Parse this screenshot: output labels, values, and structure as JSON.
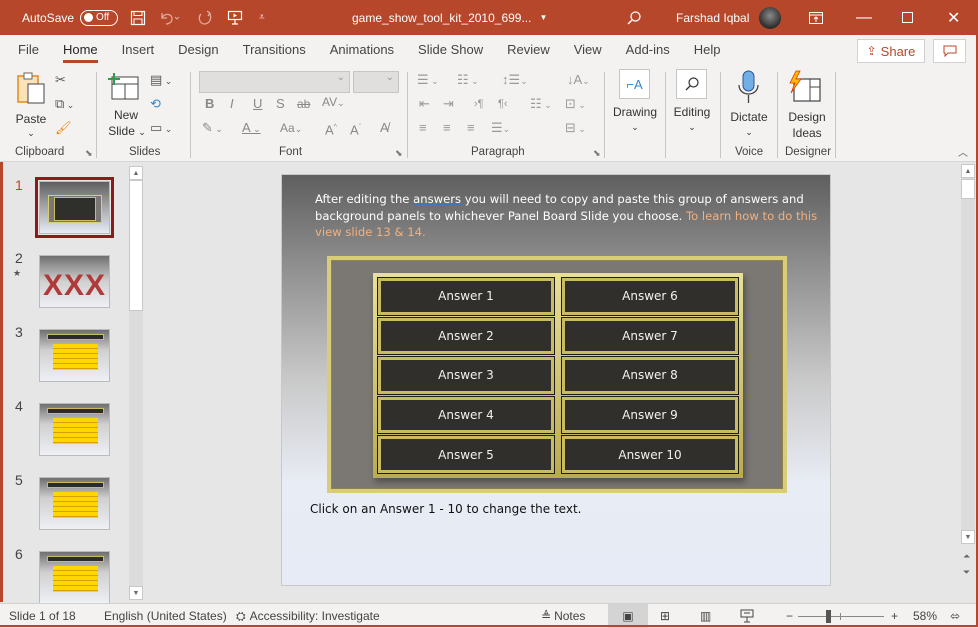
{
  "titlebar": {
    "autosave_label": "AutoSave",
    "autosave_state": "Off",
    "document_title": "game_show_tool_kit_2010_699...",
    "user_name": "Farshad Iqbal",
    "icons": [
      "save-icon",
      "undo-icon",
      "redo-icon",
      "present-from-beginning-icon",
      "customize-qat-icon",
      "search-icon",
      "ribbon-display-options-icon",
      "minimize-icon",
      "maximize-icon",
      "close-icon"
    ]
  },
  "tabs": [
    {
      "label": "File"
    },
    {
      "label": "Home",
      "active": true
    },
    {
      "label": "Insert"
    },
    {
      "label": "Design"
    },
    {
      "label": "Transitions"
    },
    {
      "label": "Animations"
    },
    {
      "label": "Slide Show"
    },
    {
      "label": "Review"
    },
    {
      "label": "View"
    },
    {
      "label": "Add-ins"
    },
    {
      "label": "Help"
    }
  ],
  "share_label": "Share",
  "ribbon": {
    "groups": {
      "clipboard": "Clipboard",
      "slides": "Slides",
      "font": "Font",
      "paragraph": "Paragraph",
      "voice": "Voice",
      "designer": "Designer"
    },
    "paste_label": "Paste",
    "new_slide_label_1": "New",
    "new_slide_label_2": "Slide",
    "font_name": "",
    "font_size": "",
    "drawing_label": "Drawing",
    "editing_label": "Editing",
    "dictate_label": "Dictate",
    "design_ideas_label_1": "Design",
    "design_ideas_label_2": "Ideas"
  },
  "thumbnails": [
    {
      "number": "1",
      "selected": true
    },
    {
      "number": "2",
      "has_animation": true
    },
    {
      "number": "3"
    },
    {
      "number": "4"
    },
    {
      "number": "5"
    },
    {
      "number": "6"
    }
  ],
  "slide": {
    "intro_part1": "After editing the ",
    "intro_underlined": "answers",
    "intro_part2": " you will need to copy and paste this group of answers and background panels to whichever Panel Board Slide you choose.  ",
    "intro_link": "To learn how to do this view slide 13 & 14.",
    "answers": [
      "Answer  1",
      "Answer 2",
      "Answer 3",
      "Answer 4",
      "Answer 5",
      "Answer 6",
      "Answer 7",
      "Answer 8",
      "Answer 9",
      "Answer 10"
    ],
    "footer": "Click on an Answer 1 - 10 to change the text."
  },
  "statusbar": {
    "slide_position": "Slide 1 of 18",
    "language": "English (United States)",
    "accessibility": "Accessibility: Investigate",
    "notes_label": "Notes",
    "zoom_level": "58%",
    "zoom_fraction": 0.35
  },
  "colors": {
    "accent": "#b7472a",
    "link": "#f3b07d",
    "frame_gold": "#d9cd79"
  }
}
